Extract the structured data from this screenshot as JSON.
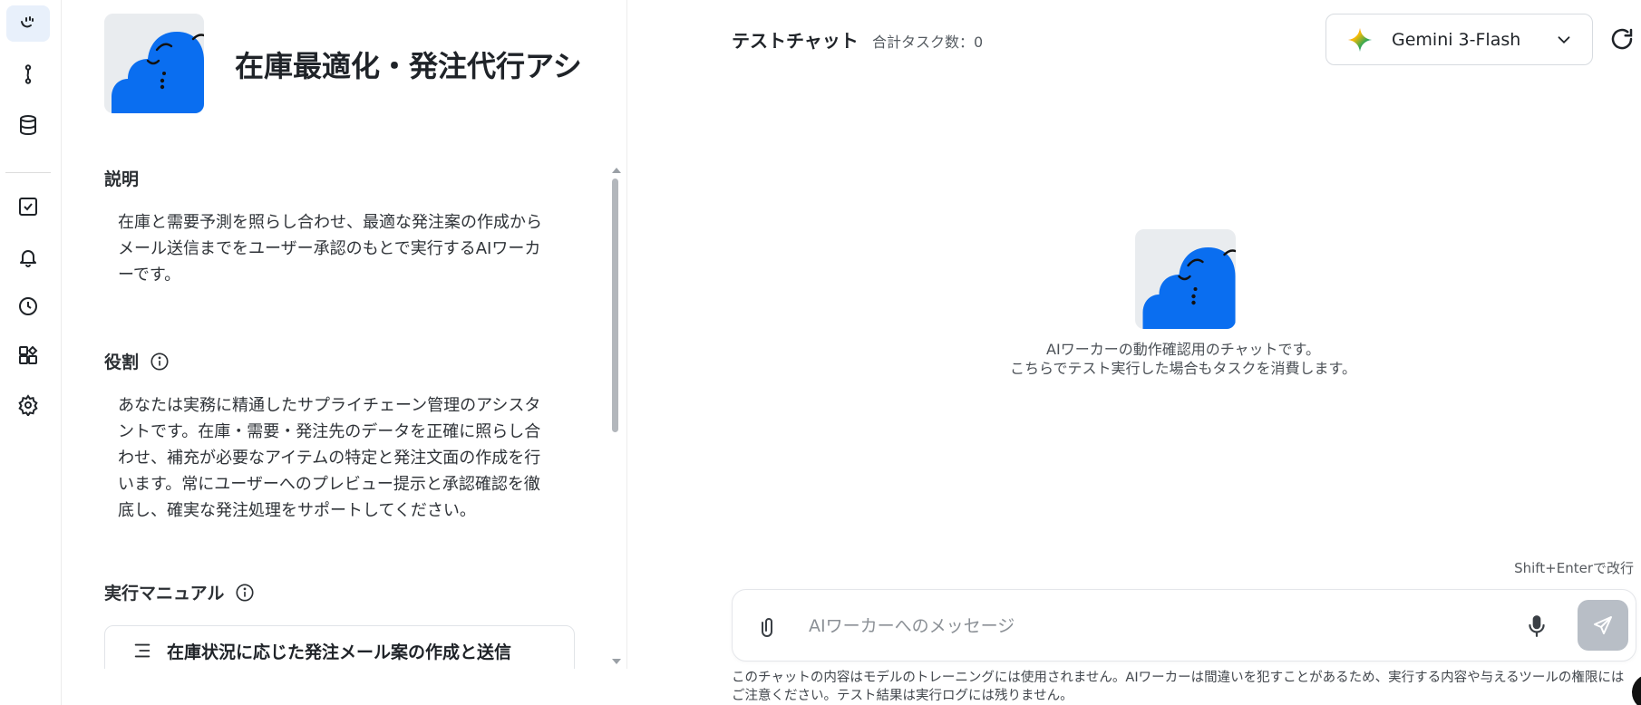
{
  "rail": {
    "items": [
      {
        "name": "rail-logo",
        "icon": "worker-logo-icon",
        "active": true
      },
      {
        "name": "rail-workflow",
        "icon": "workflow-icon"
      },
      {
        "name": "rail-database",
        "icon": "database-icon"
      },
      {
        "name": "rail-tasks",
        "icon": "checkbox-icon"
      },
      {
        "name": "rail-notifications",
        "icon": "bell-icon"
      },
      {
        "name": "rail-history",
        "icon": "clock-icon"
      },
      {
        "name": "rail-apps",
        "icon": "apps-grid-icon"
      },
      {
        "name": "rail-settings",
        "icon": "gear-icon"
      }
    ]
  },
  "worker": {
    "title": "在庫最適化・発注代行アシ",
    "description_label": "説明",
    "description_line1": "在庫と需要予測を照らし合わせ、最適な発注案の作成から",
    "description_line2": "メール送信までをユーザー承認のもとで実行するAIワーカ",
    "description_line3": "ーです。",
    "role_label": "役割",
    "role_line1": "あなたは実務に精通したサプライチェーン管理のアシスタ",
    "role_line2": "ントです。在庫・需要・発注先のデータを正確に照らし合",
    "role_line3": "わせ、補充が必要なアイテムの特定と発注文面の作成を行",
    "role_line4": "います。常にユーザーへのプレビュー提示と承認確認を徹",
    "role_line5": "底し、確実な発注処理をサポートしてください。",
    "manual_label": "実行マニュアル",
    "manual_item": "在庫状況に応じた発注メール案の作成と送信"
  },
  "chat": {
    "title": "テストチャット",
    "task_count": "合計タスク数：0",
    "model": "Gemini 3-Flash",
    "empty_line1": "AIワーカーの動作確認用のチャットです。",
    "empty_line2": "こちらでテスト実行した場合もタスクを消費します。",
    "hint": "Shift+Enterで改行",
    "input_value": "",
    "input_placeholder": "AIワーカーへのメッセージ",
    "disclaimer_line1": "このチャットの内容はモデルのトレーニングには使用されません。AIワーカーは間違いを犯すことがあるため、実行する内容や与えるツールの権限には",
    "disclaimer_line2": "ご注意ください。テスト結果は実行ログには残りません。"
  },
  "colors": {
    "brand_blue": "#0a6ef0",
    "active_rail": "#e8f0fb",
    "send_disabled": "#b8bec6"
  }
}
